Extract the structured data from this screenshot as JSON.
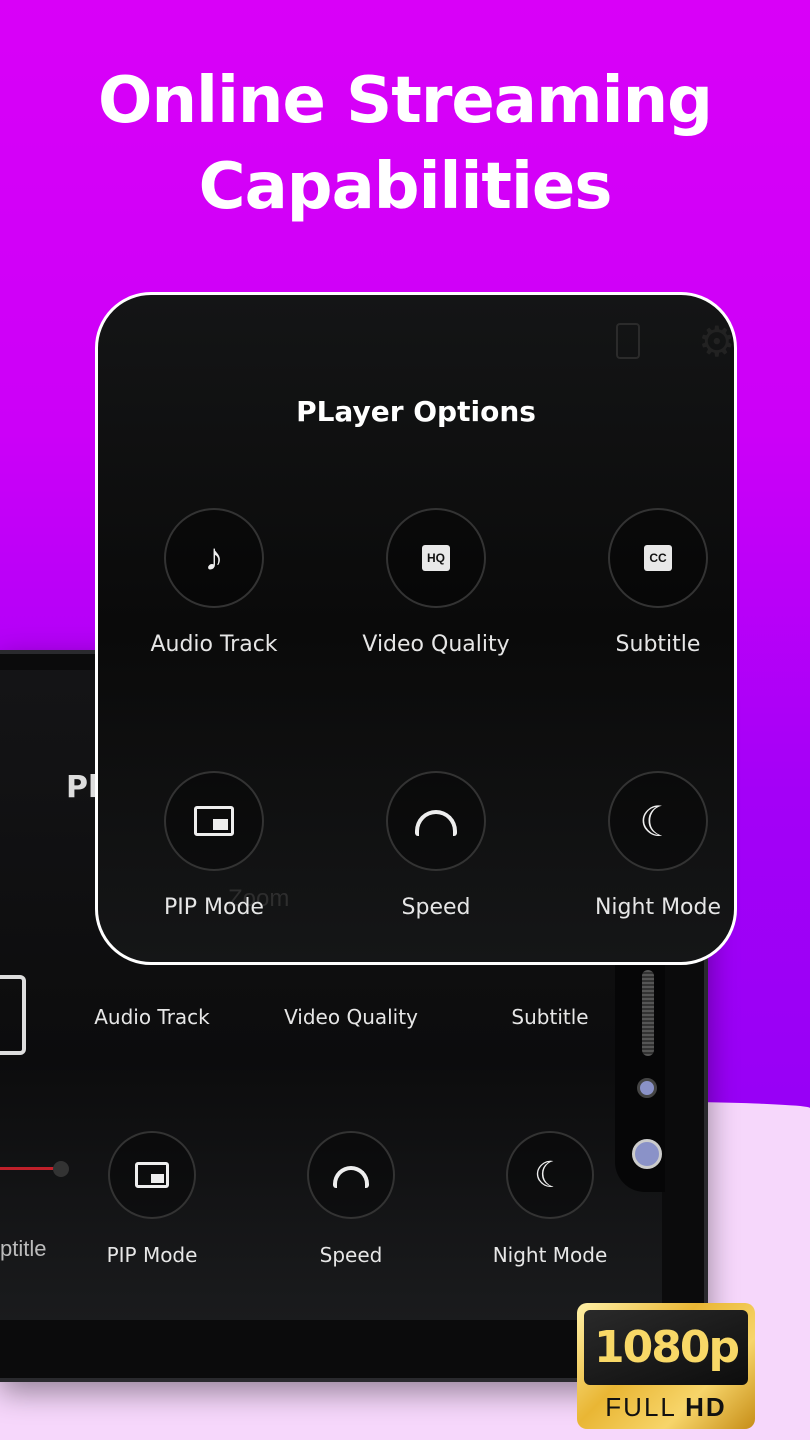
{
  "headline": [
    "Online Streaming",
    "Capabilities"
  ],
  "card": {
    "title": "PLayer Options",
    "options": [
      {
        "label": "Audio Track",
        "icon": "music-note-icon"
      },
      {
        "label": "Video Quality",
        "icon": "hq-icon"
      },
      {
        "label": "Subtitle",
        "icon": "cc-icon"
      },
      {
        "label": "PIP Mode",
        "icon": "pip-icon"
      },
      {
        "label": "Speed",
        "icon": "speedometer-icon"
      },
      {
        "label": "Night Mode",
        "icon": "moon-icon"
      }
    ]
  },
  "background_phone": {
    "title_partial": "Pl",
    "options": [
      {
        "label": "Audio Track"
      },
      {
        "label": "Video Quality"
      },
      {
        "label": "Subtitle"
      },
      {
        "label": "PIP Mode",
        "icon": "pip-icon"
      },
      {
        "label": "Speed",
        "icon": "speedometer-icon"
      },
      {
        "label": "Night Mode",
        "icon": "moon-icon"
      }
    ],
    "ghost_text": "Zoom",
    "subtitle_partial": "ptitle"
  },
  "badge": {
    "resolution": "1080p",
    "full": "FULL",
    "hd": "HD"
  },
  "colors": {
    "bg_top": "#d900f8",
    "bg_mid": "#9600f6",
    "bg_bottom": "#f6d7fb",
    "badge_gold": "#f8d867"
  }
}
